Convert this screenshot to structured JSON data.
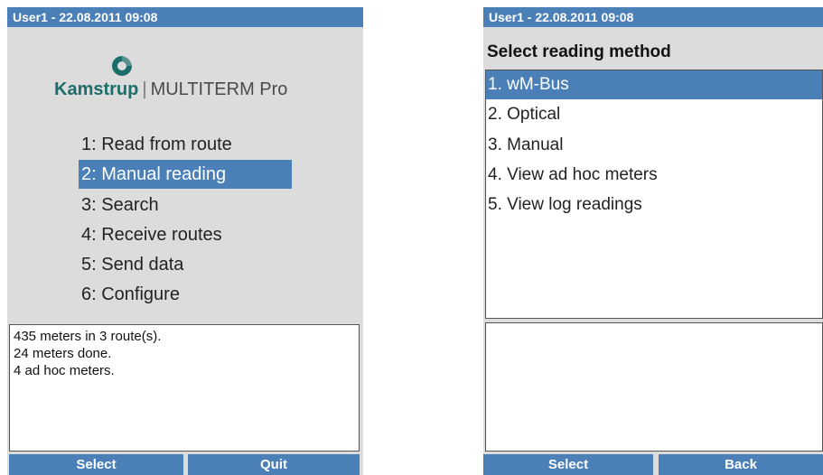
{
  "left_screen": {
    "title": "User1 - 22.08.2011 09:08",
    "logo": {
      "brand": "Kamstrup",
      "separator": "|",
      "product": "MULTITERM Pro"
    },
    "menu": [
      "1: Read from route",
      "2: Manual reading",
      "3: Search",
      "4: Receive routes",
      "5: Send data",
      "6: Configure"
    ],
    "selected_index": 1,
    "info": [
      "435 meters in 3 route(s).",
      "24 meters done.",
      "4 ad hoc meters."
    ],
    "softkeys": {
      "left": "Select",
      "right": "Quit"
    }
  },
  "right_screen": {
    "title": "User1 - 22.08.2011 09:08",
    "heading": "Select reading method",
    "methods": [
      "1. wM-Bus",
      "2. Optical",
      "3. Manual",
      "4. View ad hoc meters",
      "5. View log readings"
    ],
    "selected_index": 0,
    "softkeys": {
      "left": "Select",
      "right": "Back"
    }
  },
  "colors": {
    "accent": "#4a7fb8",
    "brand": "#1c6e6a",
    "screen_bg": "#dcdcdc"
  }
}
